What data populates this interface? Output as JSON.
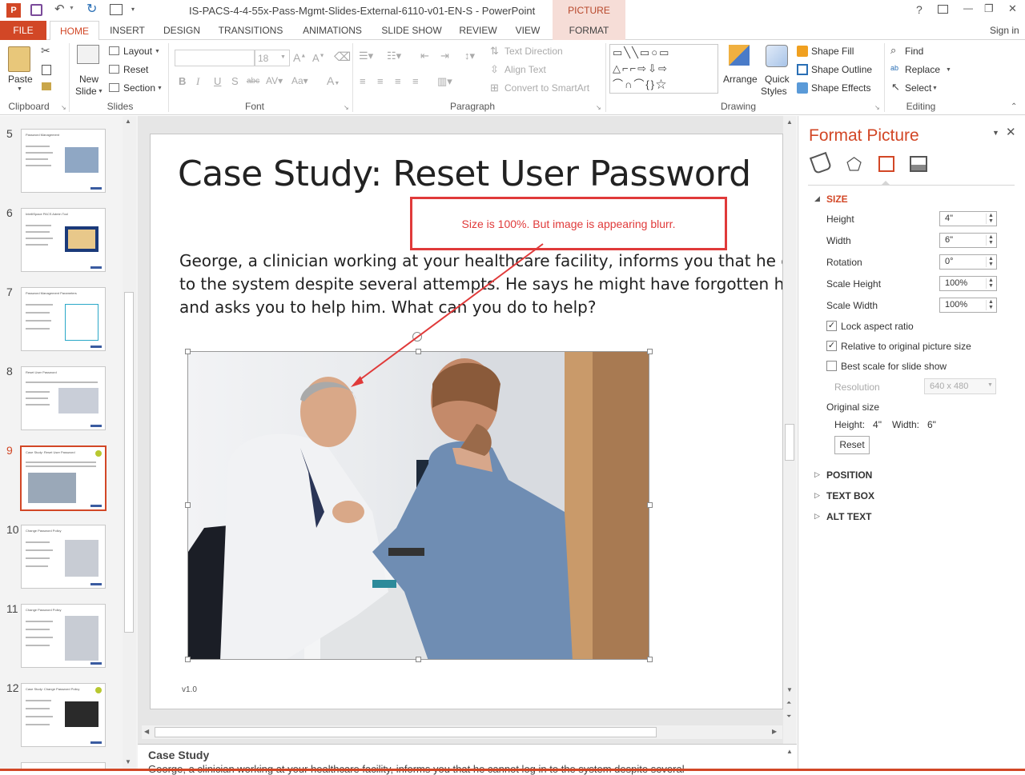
{
  "window": {
    "title": "IS-PACS-4-4-55x-Pass-Mgmt-Slides-External-6110-v01-EN-S - PowerPoint",
    "context_tab_group": "PICTURE TOOLS",
    "controls": {
      "help": "?",
      "minimize": "—",
      "restore": "❐",
      "close": "✕"
    },
    "sign_in": "Sign in"
  },
  "tabs": [
    "FILE",
    "HOME",
    "INSERT",
    "DESIGN",
    "TRANSITIONS",
    "ANIMATIONS",
    "SLIDE SHOW",
    "REVIEW",
    "VIEW",
    "FORMAT"
  ],
  "active_tab": "HOME",
  "ribbon": {
    "clipboard": {
      "label": "Clipboard",
      "paste": "Paste"
    },
    "slides": {
      "label": "Slides",
      "new_slide": "New",
      "new_slide2": "Slide",
      "layout": "Layout",
      "reset": "Reset",
      "section": "Section"
    },
    "font": {
      "label": "Font",
      "size": "18"
    },
    "paragraph": {
      "label": "Paragraph",
      "text_direction": "Text Direction",
      "align_text": "Align Text",
      "convert_smartart": "Convert to SmartArt"
    },
    "drawing": {
      "label": "Drawing",
      "arrange": "Arrange",
      "quick_styles": "Quick",
      "quick_styles2": "Styles",
      "shape_fill": "Shape Fill",
      "shape_outline": "Shape Outline",
      "shape_effects": "Shape Effects"
    },
    "editing": {
      "label": "Editing",
      "find": "Find",
      "replace": "Replace",
      "select": "Select"
    }
  },
  "thumbnails": [
    {
      "num": "5",
      "title": "Password Management"
    },
    {
      "num": "6",
      "title": "IntelliSpace PACS Admin Tool"
    },
    {
      "num": "7",
      "title": "Password Management Parameters"
    },
    {
      "num": "8",
      "title": "Reset User Password"
    },
    {
      "num": "9",
      "title": "Case Study: Reset User Password"
    },
    {
      "num": "10",
      "title": "Change Password Policy"
    },
    {
      "num": "11",
      "title": "Change Password Policy"
    },
    {
      "num": "12",
      "title": "Case Study: Change Password Policy"
    }
  ],
  "selected_thumbnail": "9",
  "slide": {
    "title": "Case Study: Reset User Password",
    "body_line1": "George, a clinician working at your healthcare facility, informs you that he can",
    "body_line2": "to the system despite several attempts. He says he might have forgotten his p",
    "body_line3": "and asks you to help him. What can you do to help?",
    "footer": "v1.0",
    "callout": "Size is 100%. But image is appearing blurr."
  },
  "notes": {
    "heading": "Case Study",
    "text": "George, a clinician working at your healthcare facility, informs you that he cannot log in to the system despite several"
  },
  "format_pane": {
    "title": "Format Picture",
    "section_size": "SIZE",
    "height_label": "Height",
    "height_value": "4\"",
    "width_label": "Width",
    "width_value": "6\"",
    "rotation_label": "Rotation",
    "rotation_value": "0°",
    "scale_height_label": "Scale Height",
    "scale_height_value": "100%",
    "scale_width_label": "Scale Width",
    "scale_width_value": "100%",
    "lock_aspect": "Lock aspect ratio",
    "relative_original": "Relative to original picture size",
    "best_scale": "Best scale for slide show",
    "resolution_label": "Resolution",
    "resolution_value": "640 x 480",
    "original_size": "Original size",
    "orig_height": "Height:   4\"",
    "orig_width": "Width:   6\"",
    "reset": "Reset",
    "section_position": "POSITION",
    "section_textbox": "TEXT BOX",
    "section_alttext": "ALT TEXT"
  },
  "colors": {
    "accent": "#d24726",
    "callout_red": "#e03a3a",
    "context_tab": "#b7472a"
  }
}
